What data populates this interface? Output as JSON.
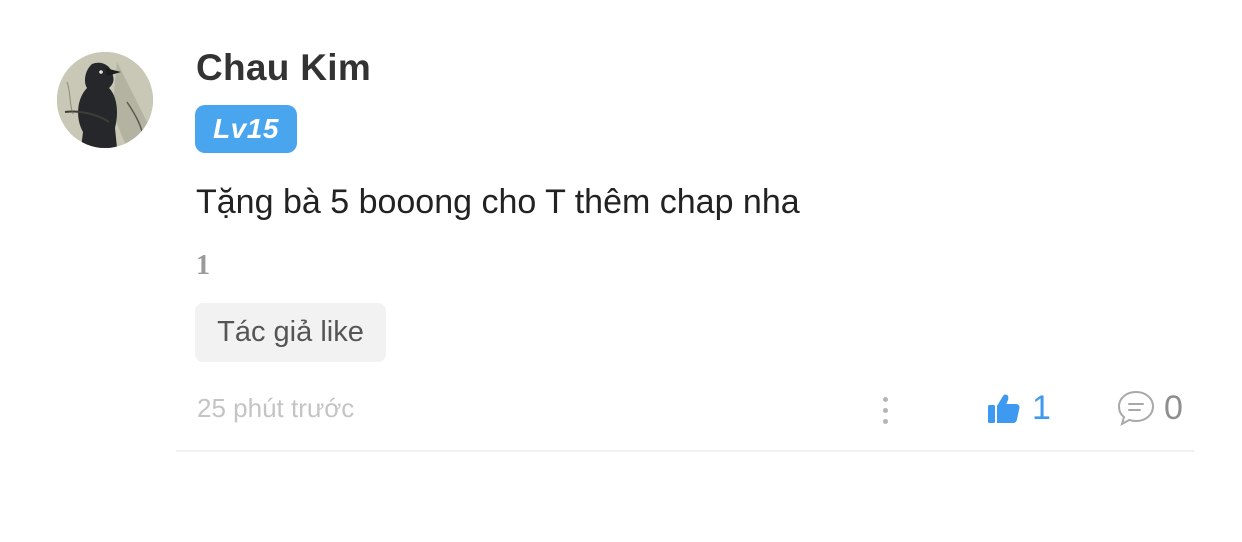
{
  "comment": {
    "author": "Chau Kim",
    "level_badge": "Lv15",
    "text": "Tặng bà 5 booong cho T thêm chap nha",
    "inline_number": "1",
    "author_like_tag": "Tác giả like",
    "timestamp": "25 phút trước",
    "like_count": "1",
    "reply_count": "0"
  },
  "icons": {
    "avatar": "crow-avatar-image",
    "more": "more-vertical-icon",
    "like": "thumbs-up-icon",
    "reply": "chat-bubble-icon"
  },
  "colors": {
    "badge": "#4aa5ef",
    "like_active": "#3d9af0",
    "muted_text": "#c4c4c4",
    "tag_background": "#f2f2f2"
  }
}
